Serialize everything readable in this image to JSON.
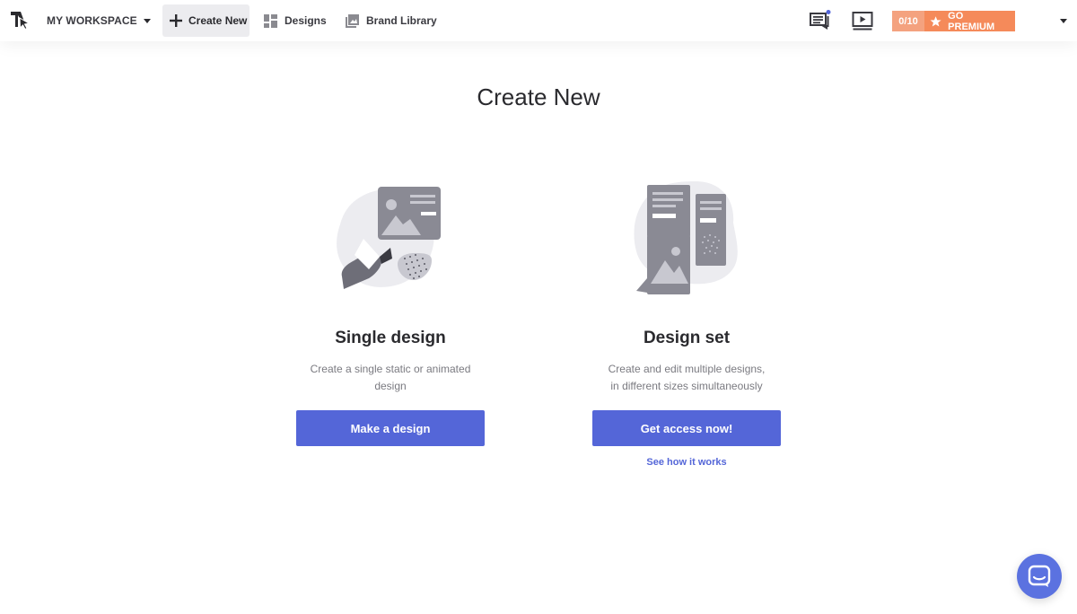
{
  "header": {
    "workspace_label": "MY WORKSPACE",
    "nav": {
      "create_new": "Create New",
      "designs": "Designs",
      "brand_library": "Brand Library"
    },
    "premium": {
      "count": "0/10",
      "cta": "GO PREMIUM"
    }
  },
  "main": {
    "title": "Create New",
    "cards": [
      {
        "title": "Single design",
        "description_line1": "Create a single static or animated",
        "description_line2": "design",
        "button": "Make a design"
      },
      {
        "title": "Design set",
        "description_line1": "Create and edit multiple designs,",
        "description_line2": "in different sizes simultaneously",
        "button": "Get access now!",
        "link": "See how it works"
      }
    ]
  },
  "icons": {
    "logo": "app-logo-icon",
    "workspace_caret": "caret-down-icon",
    "create": "plus-icon",
    "designs": "grid-icon",
    "brand_library": "image-stack-icon",
    "comments": "comments-icon",
    "tutorial": "video-icon",
    "premium": "star-icon",
    "chat": "chat-icon"
  },
  "colors": {
    "primary": "#5466d8",
    "premium_light": "#f4a27f",
    "premium": "#f58a5a",
    "notification_dot": "#5466d8"
  }
}
